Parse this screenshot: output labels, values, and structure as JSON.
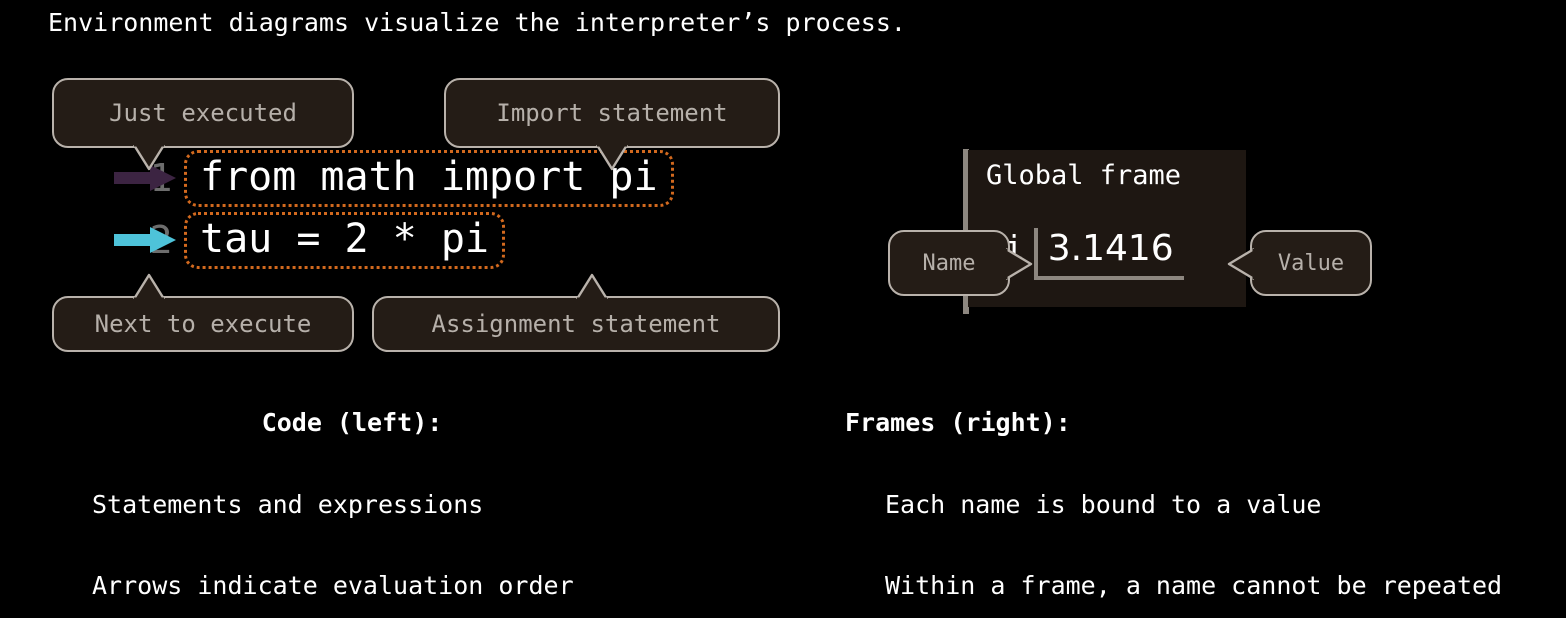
{
  "headline": "Environment diagrams visualize the interpreter’s process.",
  "colors": {
    "background": "#000000",
    "callout_fill": "#241c16",
    "callout_border": "#b9b2ab",
    "callout_text": "#b6b0aa",
    "code_box_border": "#d2691e",
    "frame_fill": "#1e1712",
    "frame_rule": "#8d8780",
    "line_number": "#6d6d6d",
    "arrow_executed": "#3c2442",
    "arrow_next": "#4ec3d9",
    "text": "#ffffff"
  },
  "code_panel": {
    "rows": [
      {
        "line_number": "1",
        "code": "from math import pi",
        "arrow_color": "#3c2442",
        "arrow_name": "just-executed-arrow"
      },
      {
        "line_number": "2",
        "code": "tau = 2 * pi",
        "arrow_color": "#4ec3d9",
        "arrow_name": "next-to-execute-arrow"
      }
    ]
  },
  "callouts": {
    "just_executed": "Just executed",
    "import_statement": "Import statement",
    "next_to_execute": "Next to execute",
    "assignment_statement": "Assignment statement",
    "name": "Name",
    "value": "Value"
  },
  "frame": {
    "title": "Global frame",
    "bindings": [
      {
        "name": "pi",
        "value": "3.1416"
      }
    ]
  },
  "columns": {
    "left": {
      "heading": "Code (left):",
      "lines": [
        "Statements and expressions",
        "Arrows indicate evaluation order"
      ]
    },
    "right": {
      "heading": "Frames (right):",
      "lines": [
        "Each name is bound to a value",
        "Within a frame, a name cannot be repeated"
      ]
    }
  }
}
